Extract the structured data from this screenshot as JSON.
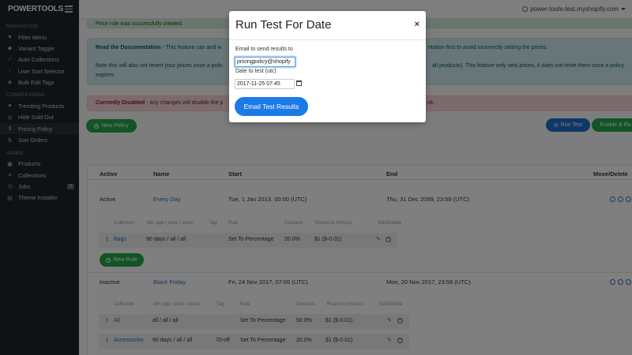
{
  "brand": "POWERTOOLS",
  "shop_name": "power-tools-test.myshopify.com",
  "sidebar": {
    "sections": [
      {
        "title": "NAVIGATION",
        "items": [
          {
            "label": "Filter Menu",
            "icon": "filter-icon"
          },
          {
            "label": "Variant Tagger",
            "icon": "tag-icon"
          },
          {
            "label": "Auto Collections",
            "icon": "wand-icon"
          },
          {
            "label": "User Sort Selector",
            "icon": "sort-icon"
          },
          {
            "label": "Bulk Edit Tags",
            "icon": "tags-icon"
          }
        ]
      },
      {
        "title": "CONVERSIONS",
        "items": [
          {
            "label": "Trending Products",
            "icon": "heart-icon"
          },
          {
            "label": "Hide Sold Out",
            "icon": "eye-off-icon"
          },
          {
            "label": "Pricing Policy",
            "icon": "dollar-icon"
          },
          {
            "label": "Sort Orders",
            "icon": "sort-arrows-icon"
          }
        ]
      },
      {
        "title": "ADMIN",
        "items": [
          {
            "label": "Products",
            "icon": "box-icon"
          },
          {
            "label": "Collections",
            "icon": "layers-icon"
          },
          {
            "label": "Jobs",
            "icon": "clock-icon",
            "badge": "0"
          },
          {
            "label": "Theme Installer",
            "icon": "paint-icon"
          }
        ]
      }
    ]
  },
  "alerts": {
    "success": "Price rule was successfully created.",
    "info_title": "Read the Documentation",
    "info_line1_a": " - This feature can and w",
    "info_line1_b": "ntation first to avoid incorrectly setting the prices.",
    "info_line2_a": "Note this will also not revert your prices once a polic",
    "info_line2_b": "all products). This feature only sets prices, it does not reset them once a policy",
    "info_line3": "expires.",
    "danger_title": "Currently Disabled",
    "danger_text": " - any changes will disable the p",
    "danger_tail": "ok."
  },
  "buttons": {
    "new_policy": "New Policy",
    "run_test": "Run Test",
    "enable": "Enable & Ru",
    "new_rule": "New Rule"
  },
  "table": {
    "headers": [
      "Active",
      "Name",
      "Start",
      "End",
      "Move/Delete"
    ],
    "sub_headers": [
      "Collection",
      "Min age / price / stock",
      "Tag",
      "Rule",
      "Discount",
      "Round to (minus)",
      "Edit/Delete"
    ],
    "policies": [
      {
        "active": "Active",
        "name": "Every Day",
        "start": "Tue, 1 Jan 2013, 00:00 (UTC)",
        "end": "Thu, 31 Dec 2099, 23:59 (UTC)",
        "rules": [
          {
            "collection": "Bags",
            "min": "90 days / all / all",
            "tag": "",
            "rule": "Set To Percentage",
            "discount": "20.0%",
            "round": "$1 ($-0.01)"
          }
        ]
      },
      {
        "active": "Inactive",
        "name": "Black Friday",
        "start": "Fri, 24 Nov 2017, 07:00 (UTC)",
        "end": "Mon, 20 Nov 2017, 23:59 (UTC)",
        "rules": [
          {
            "collection": "All",
            "min": "all / all / all",
            "tag": "",
            "rule": "Set To Percentage",
            "discount": "50.0%",
            "round": "$1 ($-0.01)"
          },
          {
            "collection": "Accessories",
            "min": "90 days / all / all",
            "tag": "70-off",
            "rule": "Set To Percentage",
            "discount": "20.0%",
            "round": "$1 ($-0.01)"
          }
        ]
      }
    ]
  },
  "modal": {
    "title": "Run Test For Date",
    "close": "×",
    "email_label": "Email to send results to",
    "email_value": "pricingpolicy@shopify",
    "date_label": "Date to test (utc)",
    "date_value": "2017-11-25 07:45",
    "submit": "Email Test Results"
  }
}
